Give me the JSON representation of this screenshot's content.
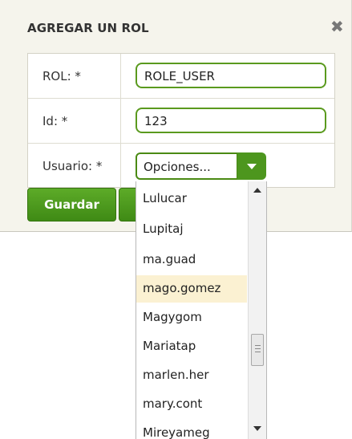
{
  "dialog": {
    "title": "AGREGAR UN ROL",
    "close_icon": "close-icon",
    "close_glyph": "✖"
  },
  "form": {
    "rol_label": "ROL: *",
    "rol_value": "ROLE_USER",
    "id_label": "Id: *",
    "id_value": "123",
    "usuario_label": "Usuario: *",
    "usuario_value": "Opciones..."
  },
  "buttons": {
    "save_label": "Guardar"
  },
  "dropdown": {
    "items": [
      "Lulucar",
      "Lupitaj",
      "ma.guad",
      "mago.gomez",
      "Magygom",
      "Mariatap",
      "marlen.her",
      "mary.cont",
      "Mireyameg"
    ],
    "highlighted": "mago.gomez"
  },
  "colors": {
    "accent": "#4d961e",
    "highlight": "#fbf1d2",
    "dialog_bg": "#f5f4ec"
  }
}
